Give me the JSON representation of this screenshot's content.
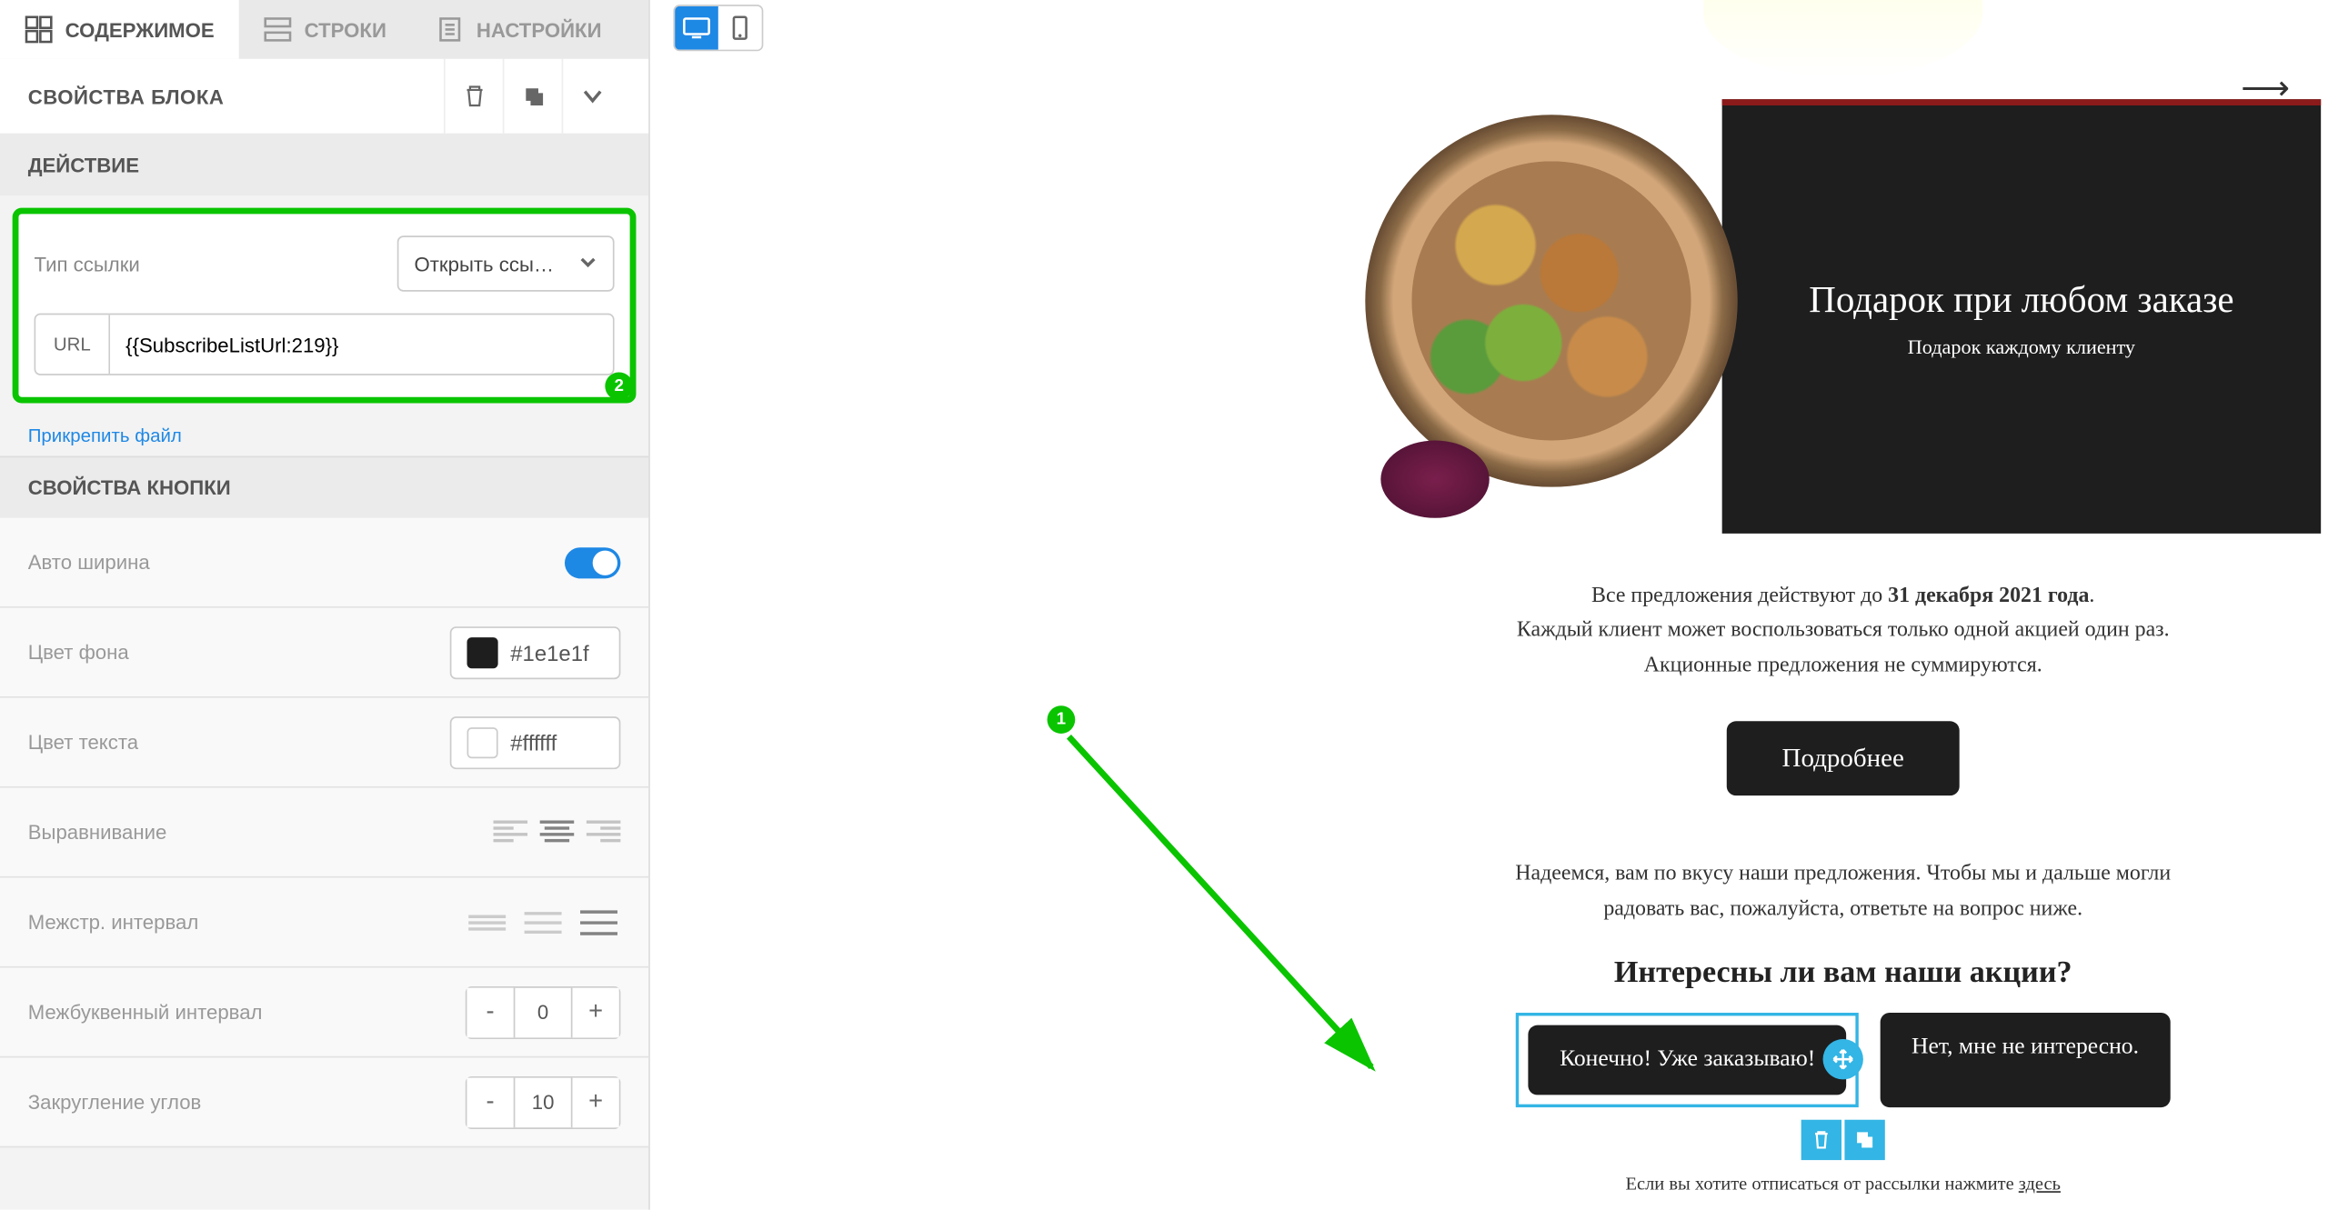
{
  "tabs": {
    "content": "СОДЕРЖИМОЕ",
    "rows": "СТРОКИ",
    "settings": "НАСТРОЙКИ"
  },
  "block": {
    "title": "СВОЙСТВА БЛОКА",
    "action_title": "ДЕЙСТВИЕ",
    "link_type_label": "Тип ссылки",
    "link_type_value": "Открыть ссы…",
    "url_label": "URL",
    "url_value": "{{SubscribeListUrl:219}}",
    "attach_file": "Прикрепить файл",
    "button_props_title": "СВОЙСТВА КНОПКИ",
    "auto_width": "Авто ширина",
    "bg_color_label": "Цвет фона",
    "bg_color_value": "#1e1e1f",
    "text_color_label": "Цвет текста",
    "text_color_value": "#ffffff",
    "align_label": "Выравнивание",
    "line_height_label": "Межстр. интервал",
    "letter_spacing_label": "Межбуквенный интервал",
    "letter_spacing_value": "0",
    "border_radius_label": "Закругление углов",
    "border_radius_value": "10"
  },
  "preview": {
    "hero_title": "Подарок при любом заказе",
    "hero_sub": "Подарок каждому клиенту",
    "terms_line1_a": "Все предложения действуют до ",
    "terms_line1_b": "31 декабря 2021 года",
    "terms_line2": "Каждый клиент может воспользоваться только одной акцией один раз.",
    "terms_line3": "Акционные предложения не суммируются.",
    "more_btn": "Подробнее",
    "hope_line1": "Надеемся, вам по вкусу наши предложения. Чтобы мы и дальше могли",
    "hope_line2": "радовать вас, пожалуйста, ответьте на вопрос ниже.",
    "question": "Интересны ли вам наши акции?",
    "yes_btn": "Конечно! Уже заказываю!",
    "no_btn": "Нет, мне не интересно.",
    "unsub_a": "Если вы хотите отписаться от рассылки нажмите ",
    "unsub_b": "здесь"
  },
  "annotations": {
    "n1": "1",
    "n2": "2"
  }
}
